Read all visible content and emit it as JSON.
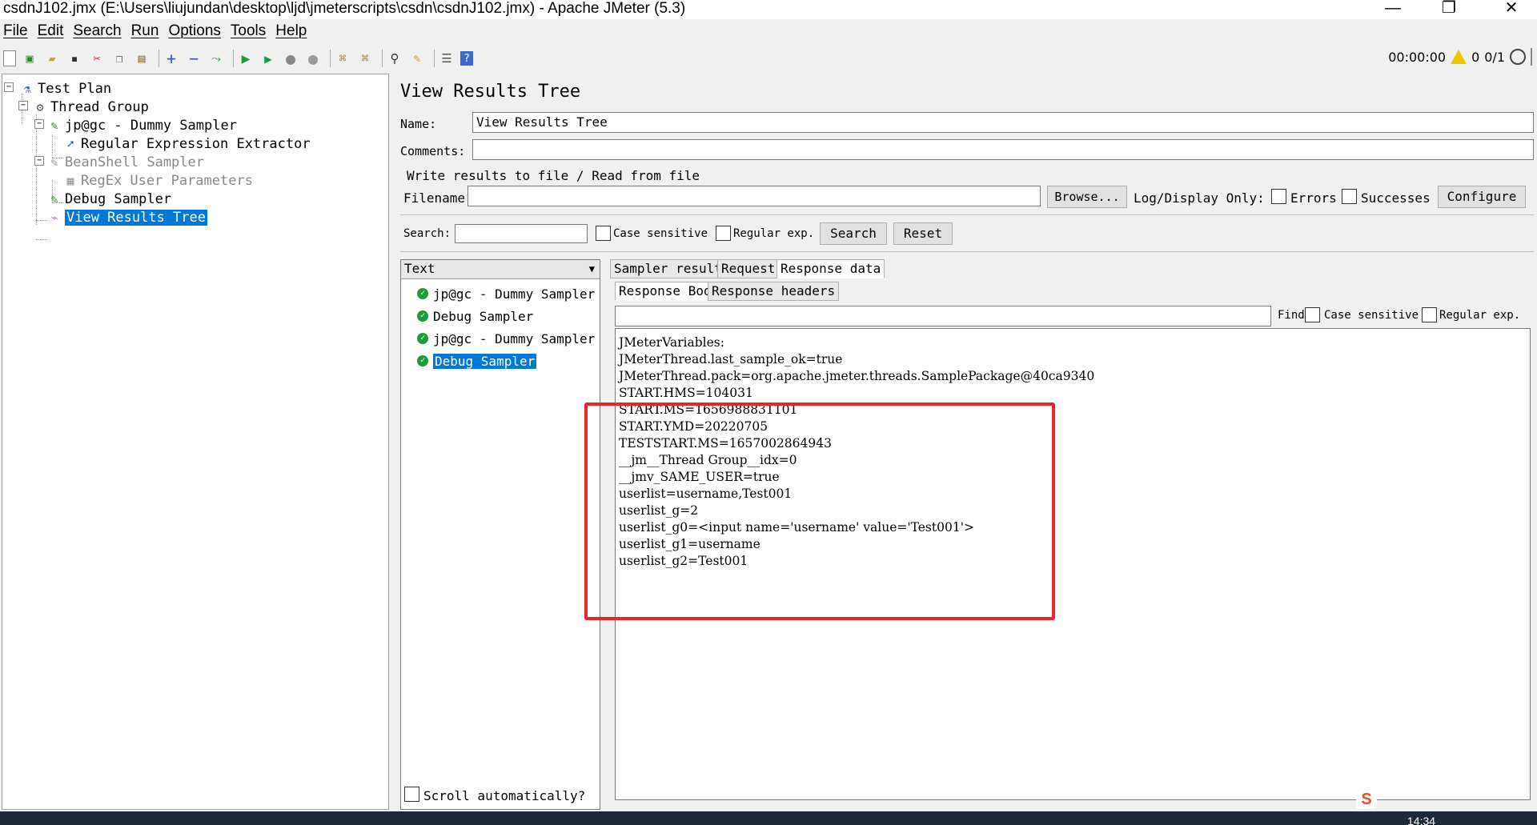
{
  "window": {
    "title": "csdnJ102.jmx (E:\\Users\\liujundan\\desktop\\ljd\\jmeterscripts\\csdn\\csdnJ102.jmx) - Apache JMeter (5.3)",
    "minimize": "—",
    "restore": "❐",
    "close": "✕"
  },
  "menu": [
    "File",
    "Edit",
    "Search",
    "Run",
    "Options",
    "Tools",
    "Help"
  ],
  "toolbar": {
    "timer": "00:00:00",
    "warnings": "0",
    "threads": "0/1"
  },
  "tree": {
    "test_plan": "Test Plan",
    "thread_group": "Thread Group",
    "dummy_sampler": "jp@gc - Dummy Sampler",
    "regex_extractor": "Regular Expression Extractor",
    "beanshell": "BeanShell Sampler",
    "regex_user_params": "RegEx User Parameters",
    "debug_sampler": "Debug Sampler",
    "view_results_tree": "View Results Tree"
  },
  "panel": {
    "title": "View Results Tree",
    "name_label": "Name:",
    "name_value": "View Results Tree",
    "comments_label": "Comments:",
    "comments_value": "",
    "write_results": "Write results to file / Read from file",
    "filename_label": "Filename",
    "filename_value": "",
    "browse": "Browse...",
    "log_display": "Log/Display Only:",
    "errors": "Errors",
    "successes": "Successes",
    "configure": "Configure",
    "search_label": "Search:",
    "search_value": "",
    "case_sensitive": "Case sensitive",
    "regular_exp": "Regular exp.",
    "search_btn": "Search",
    "reset_btn": "Reset"
  },
  "results": {
    "renderer": "Text",
    "items": [
      "jp@gc - Dummy Sampler",
      "Debug Sampler",
      "jp@gc - Dummy Sampler",
      "Debug Sampler"
    ],
    "scroll_auto": "Scroll automatically?"
  },
  "tabs": {
    "sampler_result": "Sampler result",
    "request": "Request",
    "response_data": "Response data",
    "response_body": "Response Body",
    "response_headers": "Response headers",
    "find": "Find",
    "case_sensitive": "Case sensitive",
    "regular_exp": "Regular exp."
  },
  "response_lines": [
    "JMeterVariables:",
    "JMeterThread.last_sample_ok=true",
    "JMeterThread.pack=org.apache.jmeter.threads.SamplePackage@40ca9340",
    "START.HMS=104031",
    "START.MS=1656988831101",
    "START.YMD=20220705",
    "TESTSTART.MS=1657002864943",
    "__jm__Thread Group__idx=0",
    "__jmv_SAME_USER=true",
    "userlist=username,Test001",
    "userlist_g=2",
    "userlist_g0=<input name='username' value='Test001'>",
    "userlist_g1=username",
    "userlist_g2=Test001"
  ],
  "taskbar": {
    "time": "14:34",
    "tray_app": "S"
  },
  "colors": {
    "selection": "#0078d7",
    "highlight_box": "#e8262a",
    "success_icon": "#1a9c3a"
  }
}
